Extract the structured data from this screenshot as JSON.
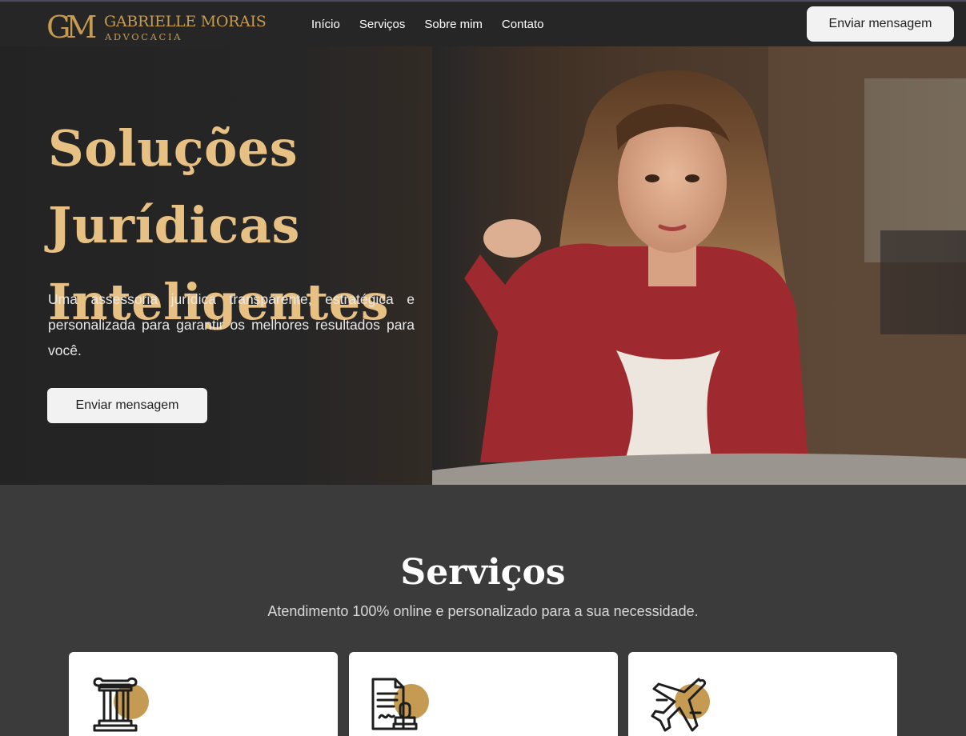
{
  "header": {
    "logo": {
      "mark": "GM",
      "name": "GABRIELLE MORAIS",
      "sub": "ADVOCACIA"
    },
    "nav": [
      {
        "label": "Início"
      },
      {
        "label": "Serviços"
      },
      {
        "label": "Sobre mim"
      },
      {
        "label": "Contato"
      }
    ],
    "cta_label": "Enviar mensagem"
  },
  "hero": {
    "title_line1": "Soluções Jurídicas",
    "title_line2": "Inteligentes",
    "text": "Uma assessoria jurídica transparente, estratégica e personalizada para garantir os melhores resultados para você.",
    "cta_label": "Enviar mensagem"
  },
  "services": {
    "title": "Serviços",
    "subtitle": "Atendimento 100% online e personalizado para a sua necessidade.",
    "cards": [
      {
        "icon": "column-icon"
      },
      {
        "icon": "contract-stamp-icon"
      },
      {
        "icon": "airplane-icon"
      }
    ]
  },
  "colors": {
    "accent_gold": "#c59a52",
    "title_gold": "#e7c083",
    "header_bg": "#262626",
    "page_bg": "#3b3b3b",
    "card_bg": "#ffffff"
  }
}
